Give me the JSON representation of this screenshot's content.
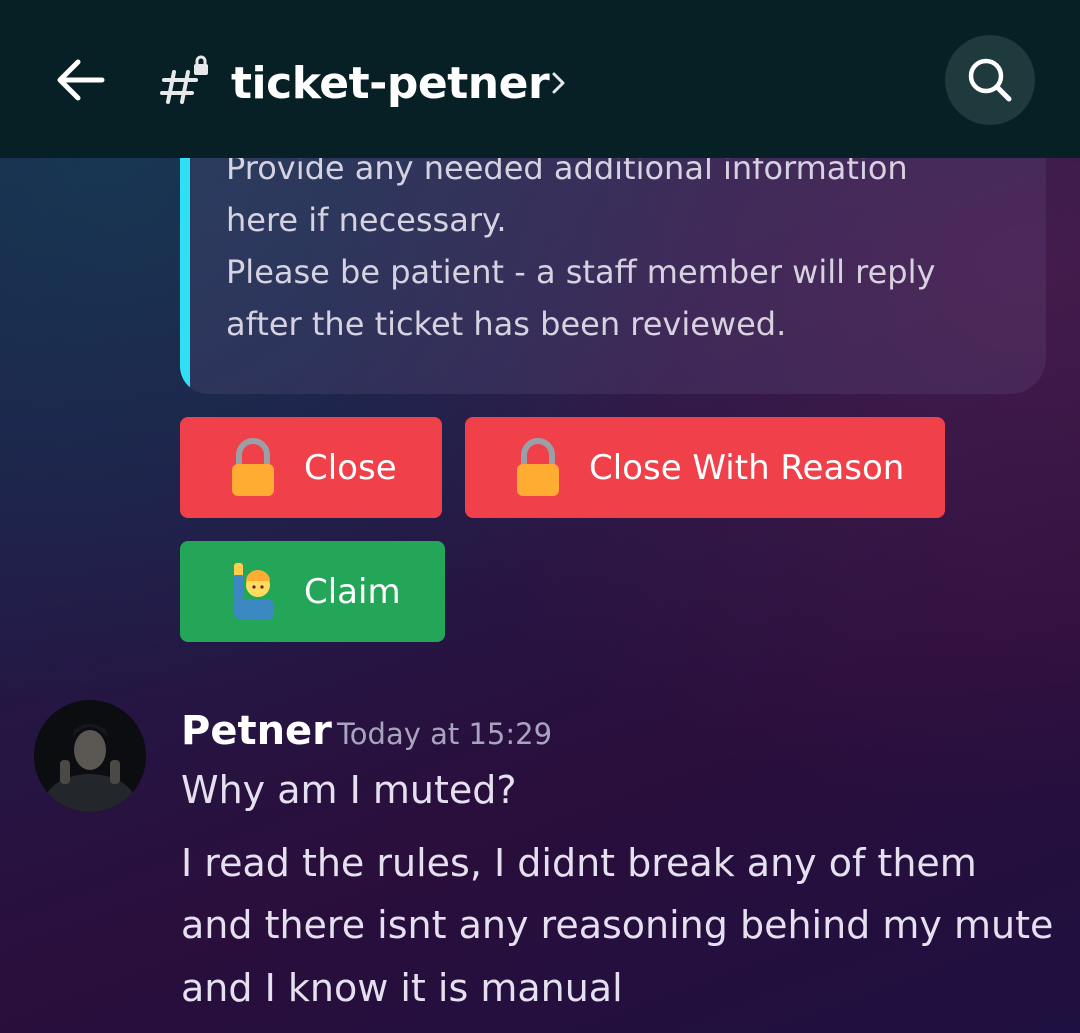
{
  "header": {
    "channel_name": "ticket-petner",
    "icons": {
      "back": "arrow-left-icon",
      "channel": "locked-hash-icon",
      "chevron": "chevron-right-icon",
      "search": "search-icon"
    }
  },
  "embed": {
    "accent_color": "#2fe0f5",
    "lines": [
      "Provide any needed additional information",
      "here if necessary.",
      "Please be patient - a staff member will reply",
      "after the ticket has been reviewed."
    ]
  },
  "buttons": [
    {
      "label": "Close",
      "icon": "lock-icon",
      "color": "#f0404a"
    },
    {
      "label": "Close With Reason",
      "icon": "lock-icon",
      "color": "#f0404a"
    },
    {
      "label": "Claim",
      "icon": "person-raising-hand-icon",
      "color": "#24a659"
    }
  ],
  "message": {
    "author": "Petner",
    "timestamp": "Today at 15:29",
    "lines": [
      "Why am I muted?",
      "I read the rules, I didnt break any of them",
      "and there isnt any reasoning behind my mute",
      "and I know it is manual"
    ]
  }
}
